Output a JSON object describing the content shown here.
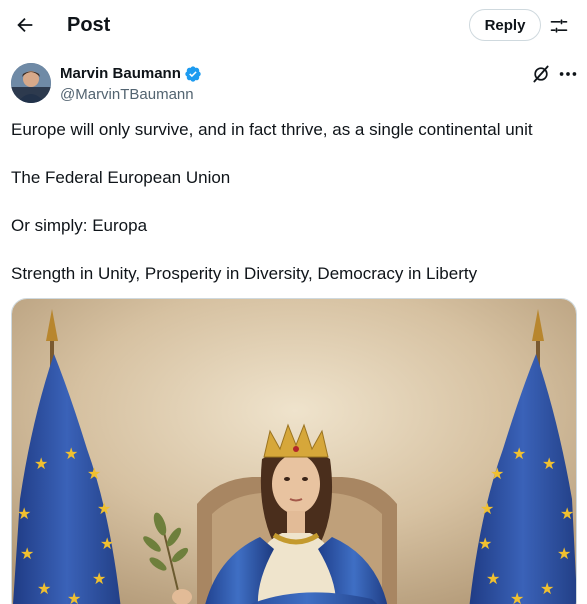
{
  "header": {
    "title": "Post",
    "reply_label": "Reply",
    "back_icon": "arrow-left-icon",
    "settings_icon": "sliders-icon"
  },
  "author": {
    "name": "Marvin Baumann",
    "handle": "@MarvinTBaumann",
    "verified": true,
    "verified_color": "#1d9bf0"
  },
  "post": {
    "lines": [
      "Europe will only survive, and in fact thrive, as a single continental unit",
      "The Federal European Union",
      "Or simply: Europa",
      "Strength in Unity, Prosperity in Diversity, Democracy in Liberty"
    ]
  },
  "media": {
    "type": "image",
    "description_icon": "image-icon"
  },
  "colors": {
    "text": "#0f1419",
    "secondary": "#536471",
    "flag_blue": "#2c4e9c",
    "flag_star": "#f0c030"
  }
}
